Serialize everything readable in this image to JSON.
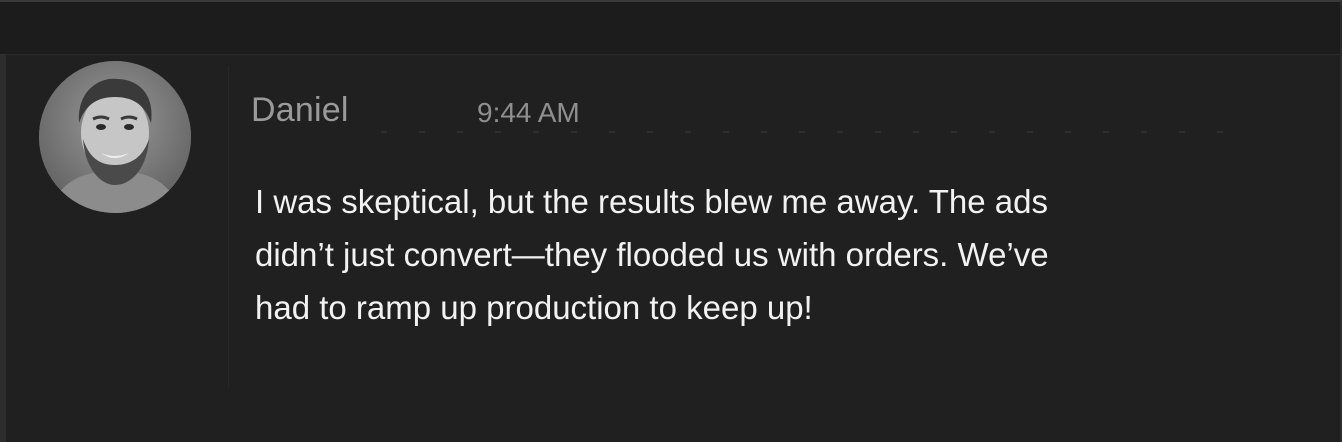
{
  "message": {
    "sender": "Daniel",
    "timestamp": "9:44 AM",
    "lines": [
      "I was skeptical, but the results blew me away. The ads",
      "didn’t just convert—they flooded us with orders. We’ve",
      "had to ramp up production to keep up!"
    ]
  },
  "colors": {
    "background": "#202020",
    "sender_text": "#9a9a9a",
    "timestamp_text": "#8f8f8f",
    "body_text": "#f2f2f2"
  }
}
